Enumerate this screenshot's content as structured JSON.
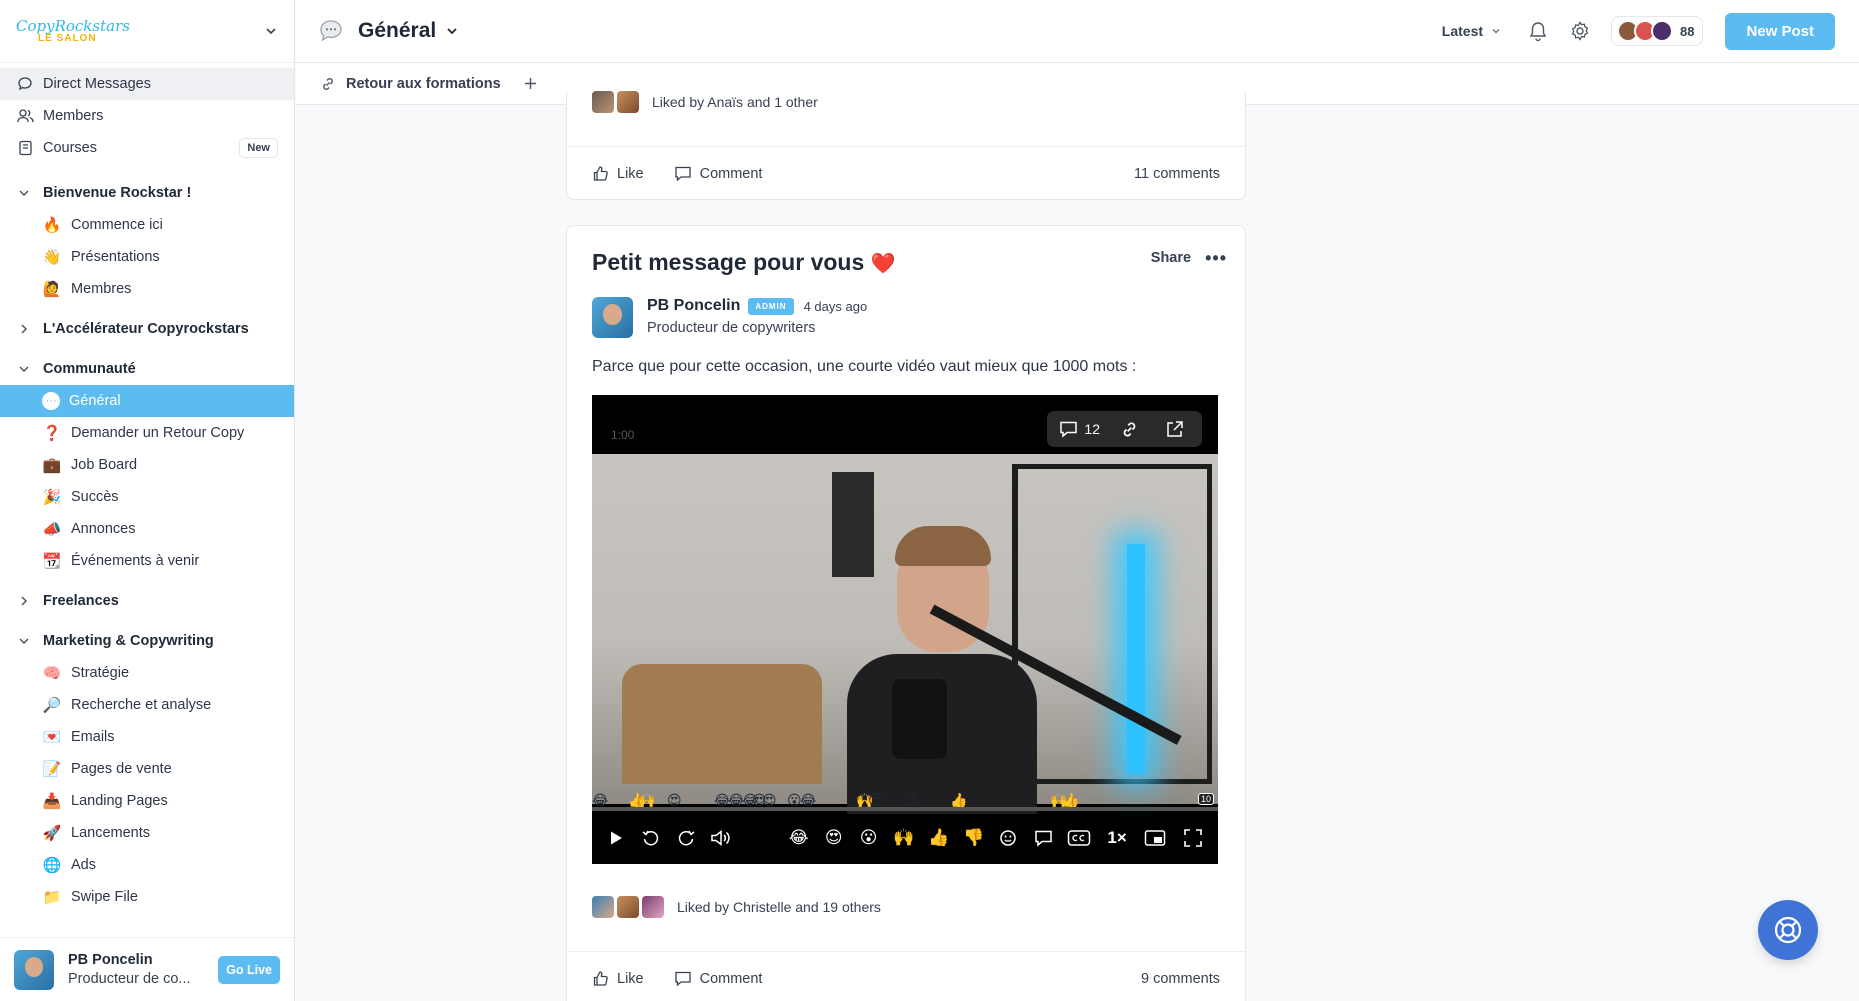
{
  "sidebar": {
    "logo": {
      "line1": "CopyRockstars",
      "line2": "LE SALON"
    },
    "top_items": [
      {
        "label": "Direct Messages",
        "icon": "chat-bubble-icon"
      },
      {
        "label": "Members",
        "icon": "members-icon"
      },
      {
        "label": "Courses",
        "icon": "book-icon",
        "badge": "New"
      }
    ],
    "sections": [
      {
        "title": "Bienvenue Rockstar !",
        "expanded": true,
        "items": [
          {
            "emoji": "🔥",
            "label": "Commence ici"
          },
          {
            "emoji": "👋",
            "label": "Présentations"
          },
          {
            "emoji": "🙋",
            "label": "Membres"
          }
        ]
      },
      {
        "title": "L'Accélérateur Copyrockstars",
        "expanded": false,
        "items": []
      },
      {
        "title": "Communauté",
        "expanded": true,
        "items": [
          {
            "emoji": "💬",
            "label": "Général",
            "active": true
          },
          {
            "emoji": "❓",
            "label": "Demander un Retour Copy"
          },
          {
            "emoji": "💼",
            "label": "Job Board"
          },
          {
            "emoji": "🎉",
            "label": "Succès"
          },
          {
            "emoji": "📣",
            "label": "Annonces"
          },
          {
            "emoji": "📆",
            "label": "Événements à venir"
          }
        ]
      },
      {
        "title": "Freelances",
        "expanded": false,
        "items": []
      },
      {
        "title": "Marketing & Copywriting",
        "expanded": true,
        "items": [
          {
            "emoji": "🧠",
            "label": "Stratégie"
          },
          {
            "emoji": "🔎",
            "label": "Recherche et analyse"
          },
          {
            "emoji": "💌",
            "label": "Emails"
          },
          {
            "emoji": "📝",
            "label": "Pages de vente"
          },
          {
            "emoji": "📥",
            "label": "Landing Pages"
          },
          {
            "emoji": "🚀",
            "label": "Lancements"
          },
          {
            "emoji": "🌐",
            "label": "Ads"
          },
          {
            "emoji": "📁",
            "label": "Swipe File"
          }
        ]
      }
    ],
    "footer": {
      "name": "PB Poncelin",
      "role": "Producteur de co...",
      "go_live": "Go Live"
    }
  },
  "topbar": {
    "title": "Général",
    "sort_label": "Latest",
    "member_count": "88",
    "new_post": "New Post"
  },
  "subbar": {
    "link_label": "Retour aux formations"
  },
  "posts": [
    {
      "likes_text": "Liked by Anaïs and 1 other",
      "like_label": "Like",
      "comment_label": "Comment",
      "comments_count": "11 comments"
    },
    {
      "title": "Petit message pour vous",
      "title_emoji": "❤️",
      "share_label": "Share",
      "author": {
        "name": "PB Poncelin",
        "badge": "ADMIN",
        "time": "4 days ago",
        "role": "Producteur de copywriters"
      },
      "body": "Parce que pour cette occasion, une courte vidéo vaut mieux que 1000 mots :",
      "video": {
        "time_label": "1:00",
        "comment_count": "12",
        "speed": "1×",
        "reaction_buttons": [
          "😂",
          "😍",
          "😮",
          "🙌",
          "👍",
          "👎"
        ],
        "timeline_badge": "10"
      },
      "likes_text": "Liked by Christelle and 19 others",
      "like_label": "Like",
      "comment_label": "Comment",
      "comments_count": "9 comments"
    }
  ],
  "colors": {
    "accent": "#5cbcf2",
    "help_button": "#3f74d6"
  }
}
